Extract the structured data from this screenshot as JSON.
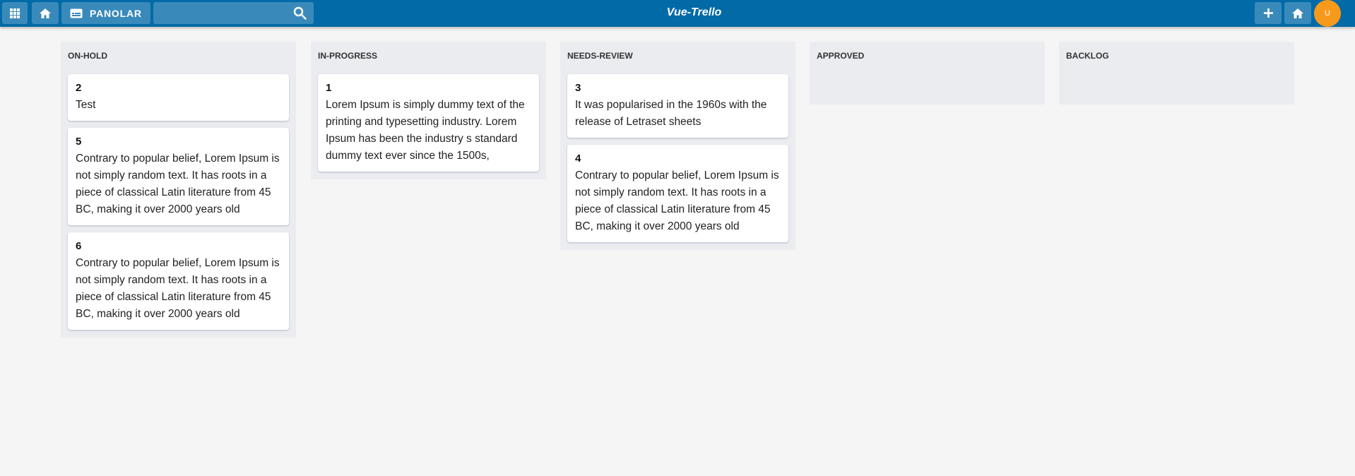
{
  "header": {
    "apps_icon": "apps-grid-icon",
    "home_icon": "home-icon",
    "boards_icon": "board-icon",
    "boards_label": "PANOLAR",
    "search_placeholder": "",
    "search_icon": "search-icon",
    "app_title": "Vue-Trello",
    "add_icon": "plus-icon",
    "avatar_initial": "U",
    "colors": {
      "bar": "#026aa7",
      "avatar": "#f79a1b"
    }
  },
  "lists": [
    {
      "title": "ON-HOLD",
      "cards": [
        {
          "id": "2",
          "text": "Test"
        },
        {
          "id": "5",
          "text": "Contrary to popular belief, Lorem Ipsum is not simply random text. It has roots in a piece of classical Latin literature from 45 BC, making it over 2000 years old"
        },
        {
          "id": "6",
          "text": "Contrary to popular belief, Lorem Ipsum is not simply random text. It has roots in a piece of classical Latin literature from 45 BC, making it over 2000 years old"
        }
      ]
    },
    {
      "title": "IN-PROGRESS",
      "cards": [
        {
          "id": "1",
          "text": "Lorem Ipsum is simply dummy text of the printing and typesetting industry. Lorem Ipsum has been the industry s standard dummy text ever since the 1500s,"
        }
      ]
    },
    {
      "title": "NEEDS-REVIEW",
      "cards": [
        {
          "id": "3",
          "text": "It was popularised in the 1960s with the release of Letraset sheets"
        },
        {
          "id": "4",
          "text": "Contrary to popular belief, Lorem Ipsum is not simply random text. It has roots in a piece of classical Latin literature from 45 BC, making it over 2000 years old"
        }
      ]
    },
    {
      "title": "APPROVED",
      "cards": []
    },
    {
      "title": "BACKLOG",
      "cards": []
    }
  ]
}
